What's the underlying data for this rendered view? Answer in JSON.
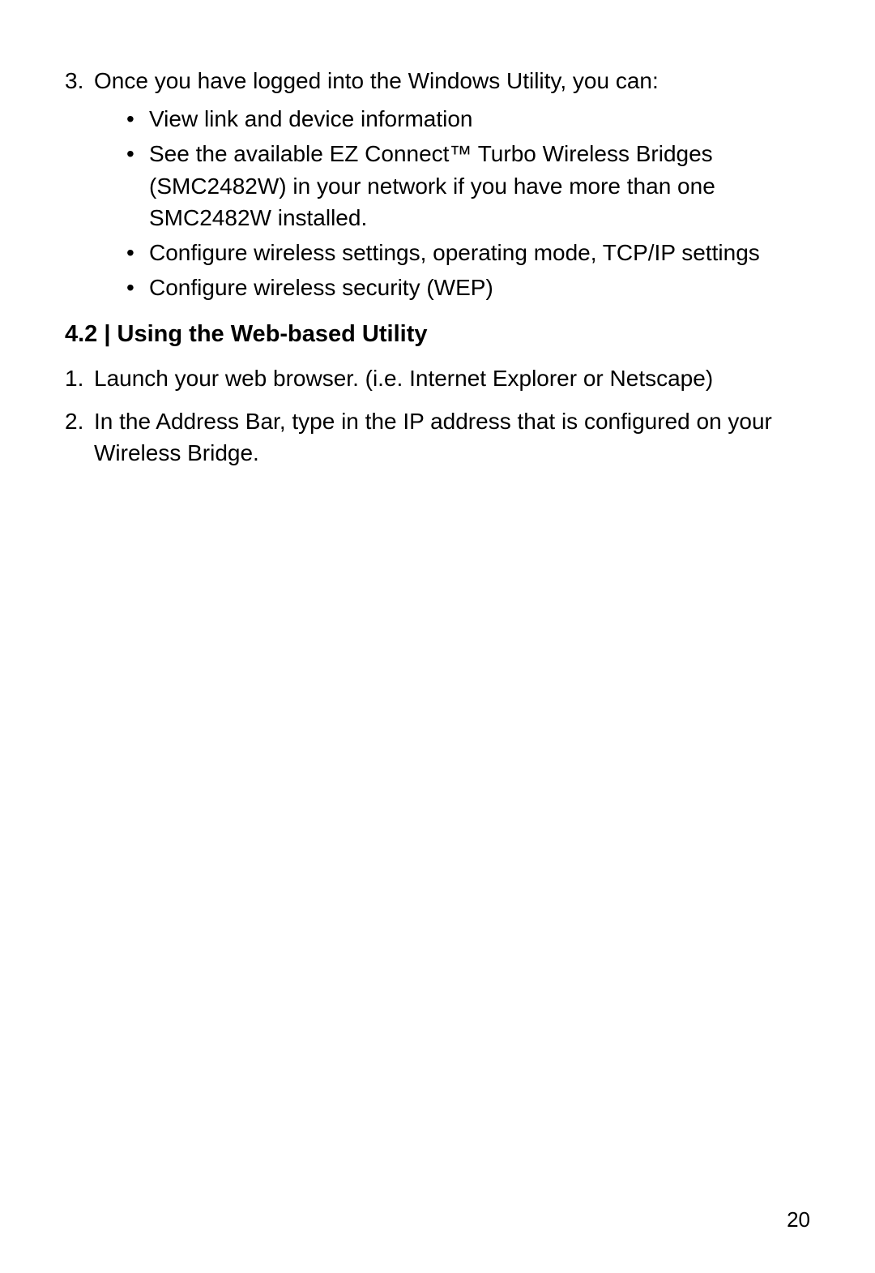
{
  "section1": {
    "item3": {
      "num": "3.",
      "text": "Once you have logged into the Windows Utility, you can:"
    },
    "bullets": [
      "View link and device information",
      "See the available EZ Connect™ Turbo Wireless Bridges (SMC2482W) in your network if you have more than one SMC2482W installed.",
      "Configure wireless settings, operating mode, TCP/IP settings",
      "Configure wireless security (WEP)"
    ]
  },
  "heading": "4.2 | Using the Web-based Utility",
  "section2": {
    "steps": [
      {
        "num": "1.",
        "text": "Launch your web browser. (i.e. Internet Explorer or Netscape)"
      },
      {
        "num": "2.",
        "text": "In the Address Bar, type in the IP address that is configured on your Wireless Bridge."
      }
    ]
  },
  "pageNumber": "20"
}
